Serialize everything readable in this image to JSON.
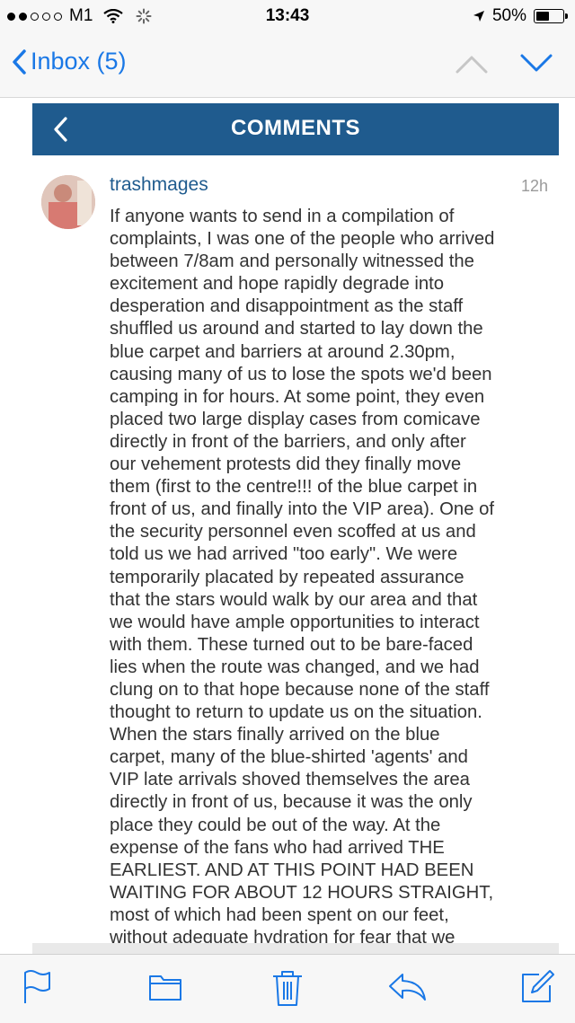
{
  "status_bar": {
    "carrier": "M1",
    "time": "13:43",
    "battery": "50%",
    "signal_bars_filled": 2,
    "signal_bars_total": 5
  },
  "nav": {
    "back_label": "Inbox (5)",
    "accent_color": "#1a78e6"
  },
  "comments_header": {
    "title": "COMMENTS",
    "bar_color": "#1f5b8e"
  },
  "comment": {
    "username": "trashmages",
    "time": "12h",
    "body": "If anyone wants to send in a compilation of\ncomplaints, I was one of the people who arrived\nbetween 7/8am and personally witnessed the\nexcitement and hope rapidly degrade into\ndesperation and disappointment as the staff\nshuffled us around and started to lay down the\nblue carpet and barriers at around 2.30pm,\ncausing many of us to lose the spots we'd been\ncamping in for hours. At some point, they even\nplaced two large display cases from comicave\ndirectly in front of the barriers, and only after\nour vehement protests did they finally move\nthem (first to the centre!!! of the blue carpet in\nfront of us, and finally into the VIP area). One of\nthe security personnel even scoffed at us and\ntold us we had arrived \"too early\". We were\ntemporarily placated by repeated assurance\nthat the stars would walk by our area and that\nwe would have ample opportunities to interact\nwith them. These turned out to be bare-faced\nlies when the route was changed, and we had\nclung on to that hope because none of the staff\nthought to return to update us on the situation.\nWhen the stars finally arrived on the blue\ncarpet, many of the blue-shirted 'agents' and\nVIP late arrivals shoved themselves the area\ndirectly in front of us, because it was the only\nplace they could be out of the way. At the\nexpense of the fans who had arrived THE\nEARLIEST. AND AT THIS POINT HAD BEEN\nWAITING FOR ABOUT 12 HOURS STRAIGHT,\nmost of which had been spent on our feet,\nwithout adequate hydration for fear that we"
  },
  "toolbar": {
    "icons": [
      "flag-icon",
      "folder-icon",
      "trash-icon",
      "reply-icon",
      "compose-icon"
    ]
  }
}
